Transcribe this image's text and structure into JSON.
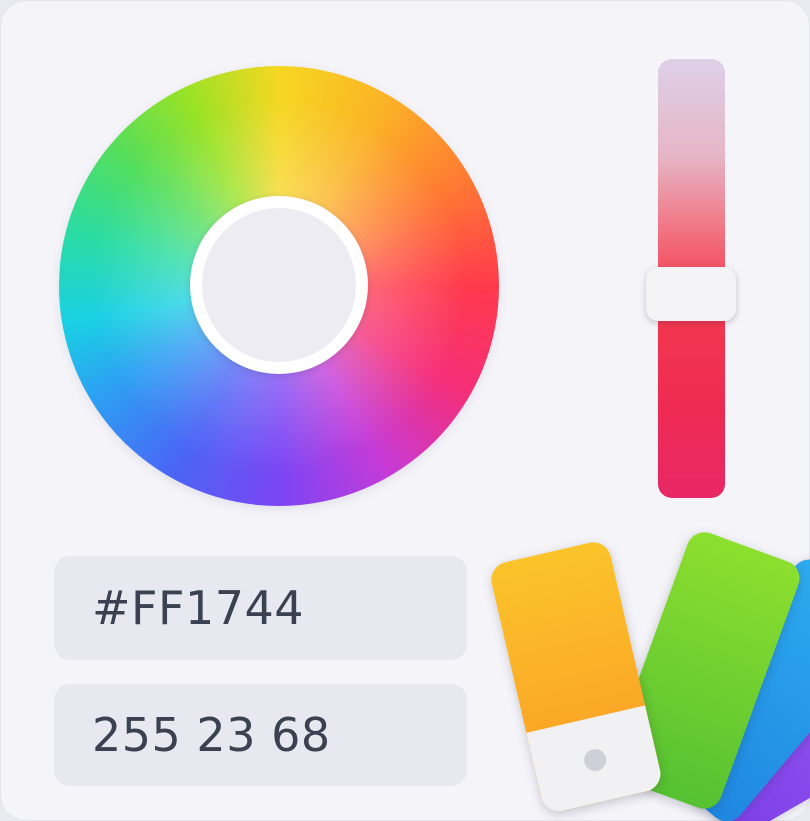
{
  "color": {
    "hex_value": "#FF1744",
    "rgb_value": "255 23 68",
    "hue_channel_level_percent": 48
  },
  "colors": {
    "selected": "#FF1744",
    "swatches": [
      "#FB9A26",
      "#55C132",
      "#1F86E0",
      "#7D3FE6"
    ]
  },
  "icons": {
    "swatch_fan": "color-swatch-fan-icon"
  }
}
